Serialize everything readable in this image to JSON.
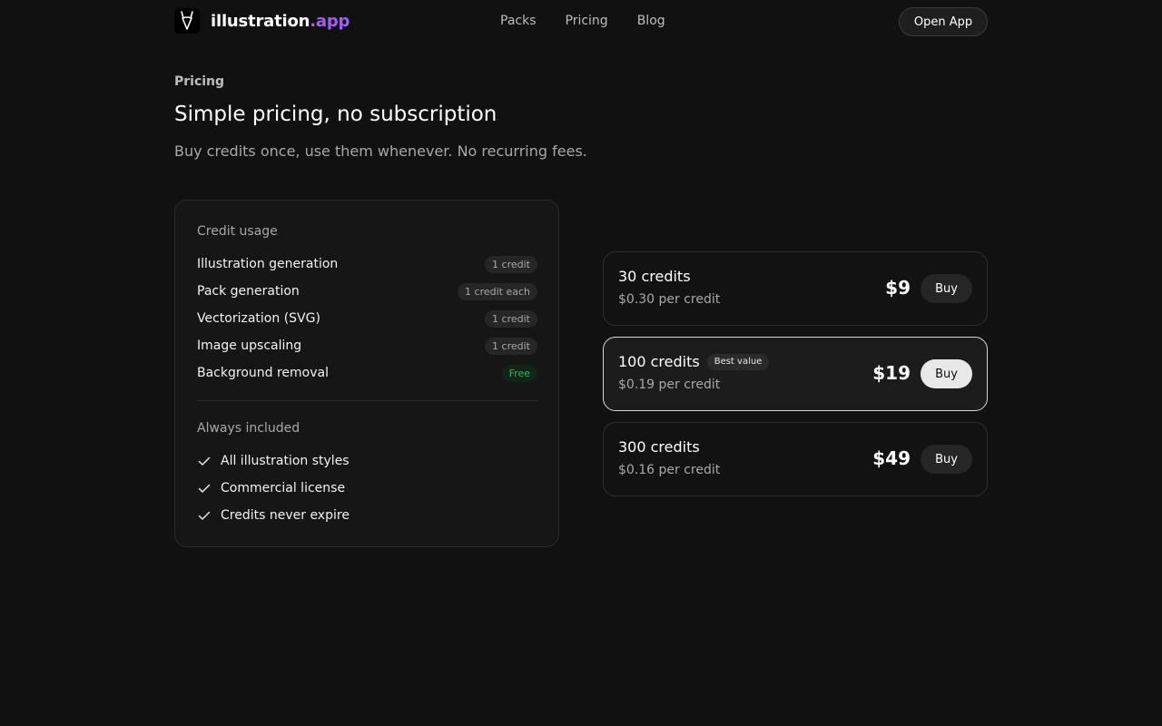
{
  "nav": {
    "logo_main": "illustration",
    "logo_accent": ".app",
    "links": [
      "Packs",
      "Pricing",
      "Blog"
    ],
    "cta": "Open App"
  },
  "header": {
    "eyebrow": "Pricing",
    "title": "Simple pricing, no subscription",
    "subtitle": "Buy credits once, use them whenever. No recurring fees."
  },
  "usage": {
    "label": "Credit usage",
    "items": [
      {
        "name": "Illustration generation",
        "cost": "1 credit"
      },
      {
        "name": "Pack generation",
        "cost": "1 credit each"
      },
      {
        "name": "Vectorization (SVG)",
        "cost": "1 credit"
      },
      {
        "name": "Image upscaling",
        "cost": "1 credit"
      },
      {
        "name": "Background removal",
        "cost": "Free"
      }
    ],
    "included_label": "Always included",
    "included": [
      "All illustration styles",
      "Commercial license",
      "Credits never expire"
    ]
  },
  "plans": [
    {
      "name": "30 credits",
      "per": "$0.30 per credit",
      "price": "$9",
      "buy": "Buy",
      "badge": ""
    },
    {
      "name": "100 credits",
      "per": "$0.19 per credit",
      "price": "$19",
      "buy": "Buy",
      "badge": "Best value"
    },
    {
      "name": "300 credits",
      "per": "$0.16 per credit",
      "price": "$49",
      "buy": "Buy",
      "badge": ""
    }
  ],
  "colors": {
    "background": "#111111",
    "accent": "#a25ff0",
    "free": "#3bb15f"
  }
}
